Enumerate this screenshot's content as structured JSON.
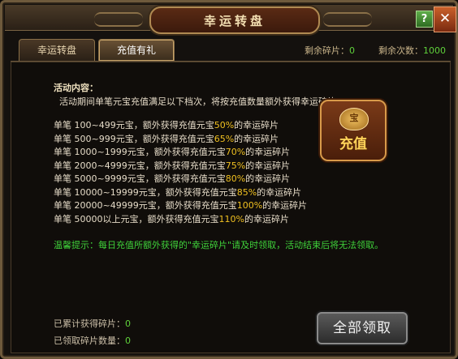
{
  "window": {
    "title": "幸运转盘",
    "help_label": "?",
    "close_label": "✕"
  },
  "tabs": [
    {
      "label": "幸运转盘",
      "active": false
    },
    {
      "label": "充值有礼",
      "active": true
    }
  ],
  "stats": {
    "remaining_fragments_label": "剩余碎片：",
    "remaining_fragments_value": "0",
    "remaining_times_label": "剩余次数：",
    "remaining_times_value": "1000"
  },
  "content": {
    "section_title": "活动内容：",
    "intro": "活动期间单笔元宝充值满足以下档次，将按充值数量额外获得幸运碎片",
    "rules": [
      {
        "pre": "单笔 100~499元宝，额外获得充值元宝",
        "pct": "50%",
        "post": "的幸运碎片"
      },
      {
        "pre": "单笔 500~999元宝，额外获得充值元宝",
        "pct": "65%",
        "post": "的幸运碎片"
      },
      {
        "pre": "单笔 1000~1999元宝，额外获得充值元宝",
        "pct": "70%",
        "post": "的幸运碎片"
      },
      {
        "pre": "单笔 2000~4999元宝，额外获得充值元宝",
        "pct": "75%",
        "post": "的幸运碎片"
      },
      {
        "pre": "单笔 5000~9999元宝，额外获得充值元宝",
        "pct": "80%",
        "post": "的幸运碎片"
      },
      {
        "pre": "单笔 10000~19999元宝，额外获得充值元宝",
        "pct": "85%",
        "post": "的幸运碎片"
      },
      {
        "pre": "单笔 20000~49999元宝，额外获得充值元宝",
        "pct": "100%",
        "post": "的幸运碎片"
      },
      {
        "pre": "单笔 50000以上元宝，额外获得充值元宝",
        "pct": "110%",
        "post": "的幸运碎片"
      }
    ],
    "tip": "温馨提示：每日充值所额外获得的\"幸运碎片\"请及时领取，活动结束后将无法领取。"
  },
  "recharge_button": {
    "label": "充值",
    "bag_label": "宝"
  },
  "bottom": {
    "accumulated_label": "已累计获得碎片：",
    "accumulated_value": "0",
    "claimed_label": "已领取碎片数量：",
    "claimed_value": "0"
  },
  "claim_button": {
    "label": "全部领取"
  },
  "colors": {
    "highlight_green": "#5fd13a",
    "percent_gold": "#f0c020",
    "frame_gold": "#b08a52"
  }
}
